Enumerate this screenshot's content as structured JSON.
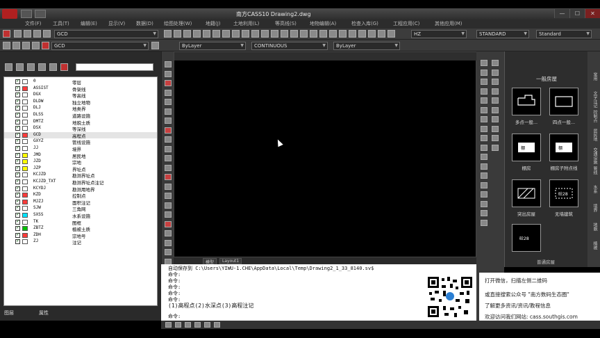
{
  "window": {
    "title": "南方CASS10   Drawing2.dwg",
    "min_label": "—",
    "max_label": "☐",
    "close_label": "✕"
  },
  "menubar": {
    "items": [
      "文件(F)",
      "工具(T)",
      "编辑(E)",
      "显示(V)",
      "数据(D)",
      "绘图处理(W)",
      "地籍(J)",
      "土地利用(L)",
      "等高线(S)",
      "地物编辑(A)",
      "检查入库(G)",
      "工程应用(C)",
      "其他应用(M)"
    ]
  },
  "toolbar": {
    "layer_combo": "GCD",
    "text_style_combo": "HZ",
    "dim_style_combo": "STANDARD",
    "table_style_combo": "Standard"
  },
  "toolbar2": {
    "layer_combo": "GCD",
    "color_combo": "ByLayer",
    "linetype_combo": "CONTINUOUS",
    "lineweight_combo": "ByLayer"
  },
  "layers": [
    {
      "name": "0",
      "desc": "零层",
      "color": "#ffffff"
    },
    {
      "name": "ASSIST",
      "desc": "骨架线",
      "color": "#ff3b3b"
    },
    {
      "name": "DGX",
      "desc": "等高线",
      "color": "#ffffff"
    },
    {
      "name": "DLDW",
      "desc": "独立地物",
      "color": "#ffffff"
    },
    {
      "name": "DLJ",
      "desc": "地类界",
      "color": "#ffffff"
    },
    {
      "name": "DLSS",
      "desc": "道路设施",
      "color": "#ffffff"
    },
    {
      "name": "DMTZ",
      "desc": "地貌土质",
      "color": "#ffffff"
    },
    {
      "name": "DSX",
      "desc": "等深线",
      "color": "#ffffff"
    },
    {
      "name": "GCD",
      "desc": "高程点",
      "color": "#ff3b3b"
    },
    {
      "name": "GXYZ",
      "desc": "管线设施",
      "color": "#ffffff"
    },
    {
      "name": "JJ",
      "desc": "境界",
      "color": "#ffffff"
    },
    {
      "name": "JMD",
      "desc": "居民地",
      "color": "#ffff00"
    },
    {
      "name": "JZD",
      "desc": "宗地",
      "color": "#ffff00"
    },
    {
      "name": "JZP",
      "desc": "界址点",
      "color": "#ffff00"
    },
    {
      "name": "KCJZD",
      "desc": "勘测界址点",
      "color": "#ffffff"
    },
    {
      "name": "KCJZD_TXT",
      "desc": "勘测界址点注记",
      "color": "#ffffff"
    },
    {
      "name": "KCYDJ",
      "desc": "勘测用地界",
      "color": "#ffffff"
    },
    {
      "name": "KZD",
      "desc": "控制点",
      "color": "#ff3b3b"
    },
    {
      "name": "MJZJ",
      "desc": "面积注记",
      "color": "#ff3b3b"
    },
    {
      "name": "SJW",
      "desc": "三角网",
      "color": "#ffffff"
    },
    {
      "name": "SXSS",
      "desc": "水系设施",
      "color": "#00e5ff"
    },
    {
      "name": "TK",
      "desc": "图框",
      "color": "#ffffff"
    },
    {
      "name": "ZBTZ",
      "desc": "植被土质",
      "color": "#00c000"
    },
    {
      "name": "ZDH",
      "desc": "宗地号",
      "color": "#ff3b3b"
    },
    {
      "name": "ZJ",
      "desc": "注记",
      "color": "#ffffff"
    }
  ],
  "selected_layer": "GCD",
  "layer_tabs": [
    "图层",
    "属性"
  ],
  "layout_tabs": [
    "模型",
    "Layout1"
  ],
  "command": {
    "lines": [
      "自动保存到 C:\\Users\\YIWU-1.CHE\\AppData\\Local\\Temp\\Drawing2_1_33_8140.sv$",
      "命令:",
      "命令:",
      "命令:",
      "命令:",
      "命令:",
      "(1)高程点(2)水深点(3)高程注记",
      "命令:"
    ]
  },
  "palette": {
    "title": "一般房屋",
    "items": [
      "多点一般...",
      "四点一般...",
      "棚房",
      "棚房子附点线",
      "突出房屋",
      "无墙建筑",
      ""
    ],
    "footer": "普通房屋"
  },
  "promo": {
    "line1": "打开微信，扫描左侧二维码",
    "line2": "或直接搜索公众号 \"南方数码生态圈\"",
    "line3": "了解更多资讯/资讯/教程信息",
    "line4": "欢迎访问我们网站: cass.southgis.com"
  },
  "right_vertical_tabs": [
    "常用",
    "文字注记",
    "控制点",
    "居民地",
    "交通设施",
    "管线",
    "水系",
    "境界",
    "地貌",
    "植被"
  ]
}
